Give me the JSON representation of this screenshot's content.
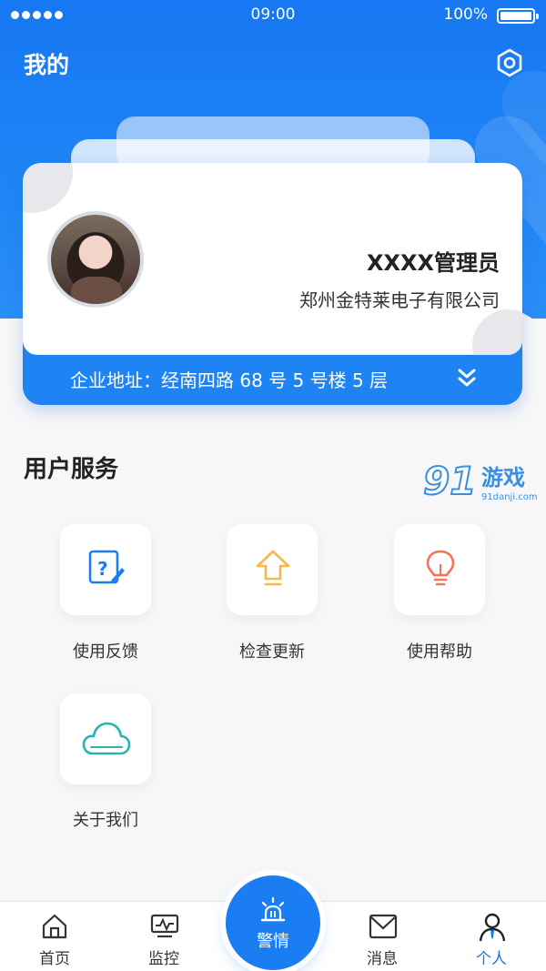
{
  "status_bar": {
    "time": "09:00",
    "battery": "100%"
  },
  "header": {
    "title": "我的"
  },
  "profile": {
    "name": "XXXX管理员",
    "company": "郑州金特莱电子有限公司",
    "address": "企业地址：经南四路 68 号 5 号楼 5 层"
  },
  "services": {
    "title": "用户服务",
    "items": [
      {
        "label": "使用反馈",
        "icon": "feedback-icon"
      },
      {
        "label": "检查更新",
        "icon": "update-icon"
      },
      {
        "label": "使用帮助",
        "icon": "help-bulb-icon"
      },
      {
        "label": "关于我们",
        "icon": "cloud-icon"
      }
    ]
  },
  "watermark": {
    "brand": "游戏",
    "site": "91danji.com"
  },
  "tabbar": {
    "items": [
      {
        "label": "首页",
        "icon": "home-icon"
      },
      {
        "label": "监控",
        "icon": "monitor-icon"
      },
      {
        "label": "警情",
        "icon": "alarm-icon"
      },
      {
        "label": "消息",
        "icon": "mail-icon"
      },
      {
        "label": "个人",
        "icon": "user-icon"
      }
    ],
    "active": "个人"
  },
  "colors": {
    "primary": "#1677f2",
    "active_tab": "#1677f2",
    "update_accent": "#f5b94a",
    "help_accent": "#f2765a",
    "about_accent": "#2ab3b1"
  }
}
